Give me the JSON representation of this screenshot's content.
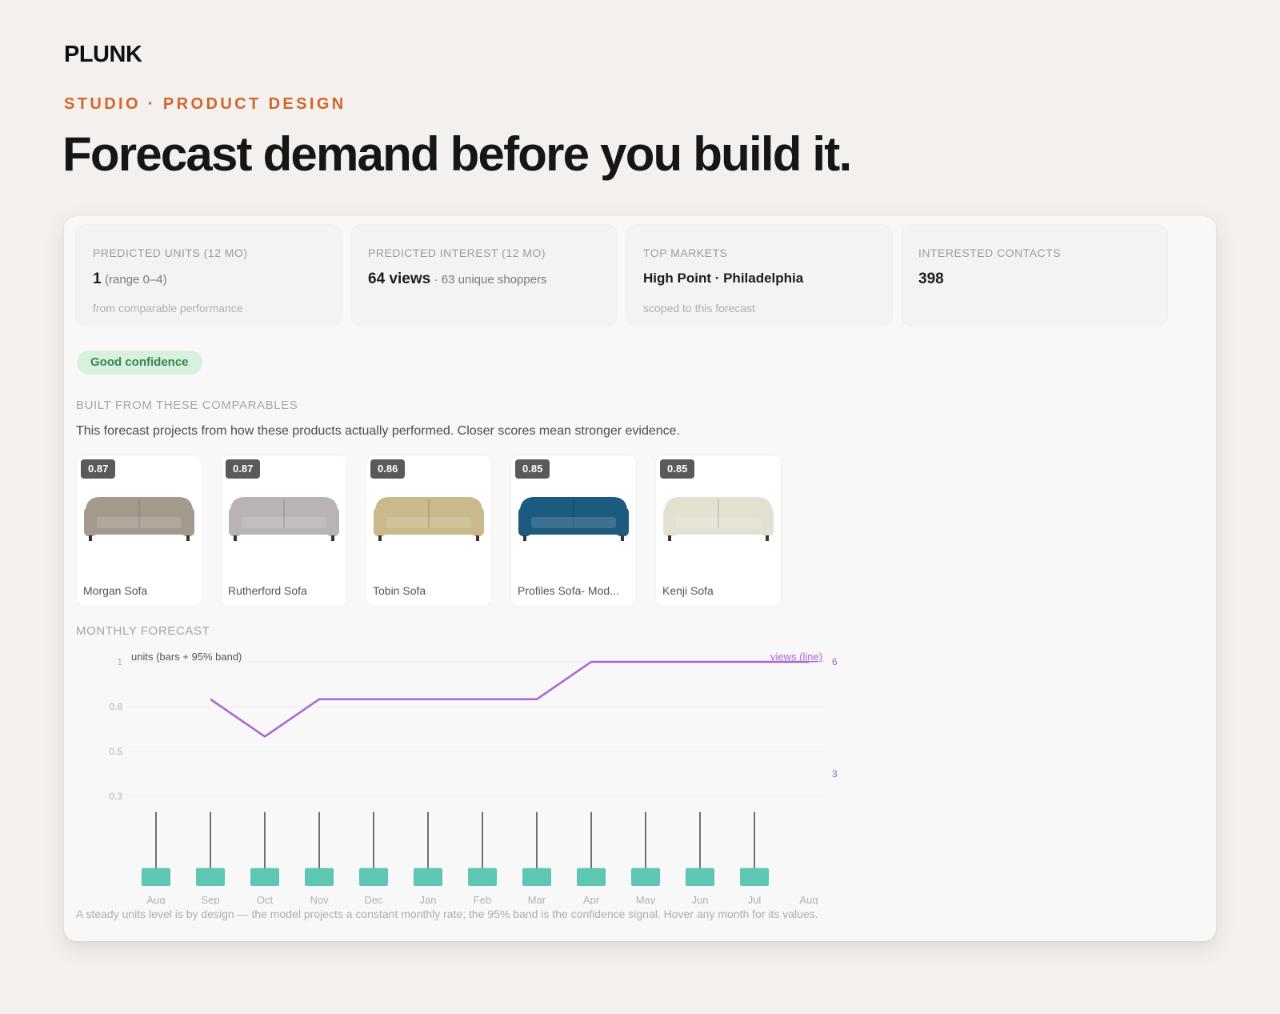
{
  "brand": "PLUNK",
  "eyebrow": "STUDIO · PRODUCT DESIGN",
  "headline": "Forecast demand before you build it.",
  "metrics": [
    {
      "label": "PREDICTED UNITS (12 MO)",
      "value": "1",
      "detail": "(range 0–4)",
      "sub": "from comparable performance"
    },
    {
      "label": "PREDICTED INTEREST (12 MO)",
      "value": "64 views",
      "detail": "· 63 unique shoppers",
      "sub": ""
    },
    {
      "label": "TOP MARKETS",
      "value": "High Point · Philadelphia",
      "detail": "",
      "sub": "scoped to this forecast"
    },
    {
      "label": "INTERESTED CONTACTS",
      "value": "398",
      "detail": "",
      "sub": ""
    }
  ],
  "confidence_badge": "Good confidence",
  "comparables": {
    "title": "BUILT FROM THESE COMPARABLES",
    "description": "This forecast projects from how these products actually performed. Closer scores mean stronger evidence.",
    "items": [
      {
        "score": "0.87",
        "name": "Morgan Sofa",
        "color": "#a39a8d"
      },
      {
        "score": "0.87",
        "name": "Rutherford Sofa",
        "color": "#b9b3b4"
      },
      {
        "score": "0.86",
        "name": "Tobin Sofa",
        "color": "#c9b98b"
      },
      {
        "score": "0.85",
        "name": "Profiles Sofa- Mod...",
        "color": "#1d5a80"
      },
      {
        "score": "0.85",
        "name": "Kenji Sofa",
        "color": "#e4e0d2"
      }
    ]
  },
  "forecast": {
    "title": "MONTHLY FORECAST",
    "note": "A steady units level is by design — the model projects a constant monthly rate; the 95% band is the confidence signal. Hover any month for its values."
  },
  "chart_data": {
    "type": "bar",
    "left_axis_label": "units (bars + 95% band)",
    "right_axis_label": "views (line)",
    "categories": [
      "Aug",
      "Sep",
      "Oct",
      "Nov",
      "Dec",
      "Jan",
      "Feb",
      "Mar",
      "Apr",
      "May",
      "Jun",
      "Jul",
      "Aug"
    ],
    "units_ticks": [
      "1",
      "0.8",
      "0.5",
      "0.3"
    ],
    "units_tick_values": [
      1,
      0.8,
      0.6,
      0.4
    ],
    "views_ticks": [
      "6",
      "3"
    ],
    "views_tick_values": [
      6,
      3
    ],
    "units_ylim": [
      0,
      1
    ],
    "views_ylim": [
      0,
      6
    ],
    "series": [
      {
        "name": "units (bars + 95% band)",
        "type": "bar",
        "values": [
          0.08,
          0.08,
          0.08,
          0.08,
          0.08,
          0.08,
          0.08,
          0.08,
          0.08,
          0.08,
          0.08,
          0.08
        ],
        "band_high": [
          0.33,
          0.33,
          0.33,
          0.33,
          0.33,
          0.33,
          0.33,
          0.33,
          0.33,
          0.33,
          0.33,
          0.33
        ]
      },
      {
        "name": "views (line)",
        "type": "line",
        "values": [
          null,
          5,
          4,
          5,
          5,
          5,
          5,
          5,
          6,
          6,
          6,
          6,
          6
        ]
      }
    ],
    "colors": {
      "bar": "#5ec7b3",
      "band": "#444444",
      "line": "#a765d6",
      "grid": "#ebebeb",
      "tick": "#b2b2b2"
    },
    "grid": true
  }
}
